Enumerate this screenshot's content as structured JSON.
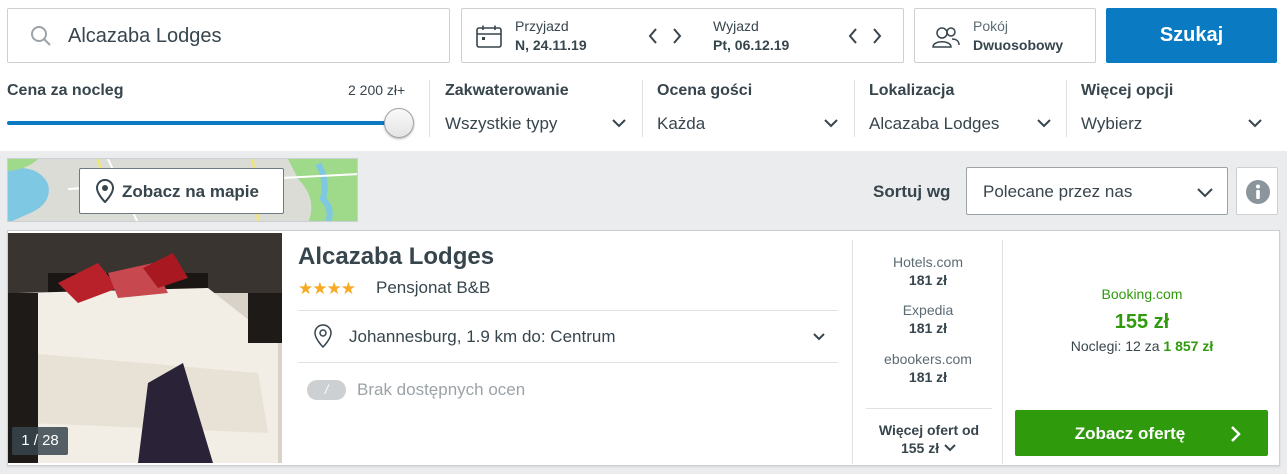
{
  "search": {
    "value": "Alcazaba Lodges",
    "button": "Szukaj"
  },
  "dates": {
    "checkin_label": "Przyjazd",
    "checkin_value": "N, 24.11.19",
    "checkout_label": "Wyjazd",
    "checkout_value": "Pt, 06.12.19"
  },
  "rooms": {
    "label": "Pokój",
    "value": "Dwuosobowy"
  },
  "filters": {
    "price": {
      "title": "Cena za nocleg",
      "max": "2 200 zł+",
      "level_fraction": 1.0
    },
    "lodging": {
      "title": "Zakwaterowanie",
      "value": "Wszystkie typy"
    },
    "rating": {
      "title": "Ocena gości",
      "value": "Każda"
    },
    "location": {
      "title": "Lokalizacja",
      "value": "Alcazaba Lodges"
    },
    "more": {
      "title": "Więcej opcji",
      "value": "Wybierz"
    }
  },
  "map": {
    "button": "Zobacz na mapie"
  },
  "sort": {
    "label": "Sortuj wg",
    "value": "Polecane przez nas"
  },
  "hotel": {
    "name": "Alcazaba Lodges",
    "stars": "★★★★",
    "star_count": 4,
    "type": "Pensjonat B&B",
    "location": "Johannesburg, 1.9 km do: Centrum",
    "rating_badge": "/",
    "rating_text": "Brak dostępnych ocen",
    "photo_counter": "1 / 28",
    "providers": [
      {
        "name": "Hotels.com",
        "price": "181 zł"
      },
      {
        "name": "Expedia",
        "price": "181 zł"
      },
      {
        "name": "ebookers.com",
        "price": "181 zł"
      }
    ],
    "more_offers_label": "Więcej ofert od",
    "more_offers_price": "155 zł",
    "best": {
      "provider": "Booking.com",
      "price": "155 zł",
      "nights_prefix": "Noclegi: 12 za ",
      "nights_total": "1 857 zł",
      "button": "Zobacz ofertę"
    }
  },
  "colors": {
    "accent": "#0a7ac2",
    "deal": "#2f9a0c",
    "star": "#f8a822"
  }
}
